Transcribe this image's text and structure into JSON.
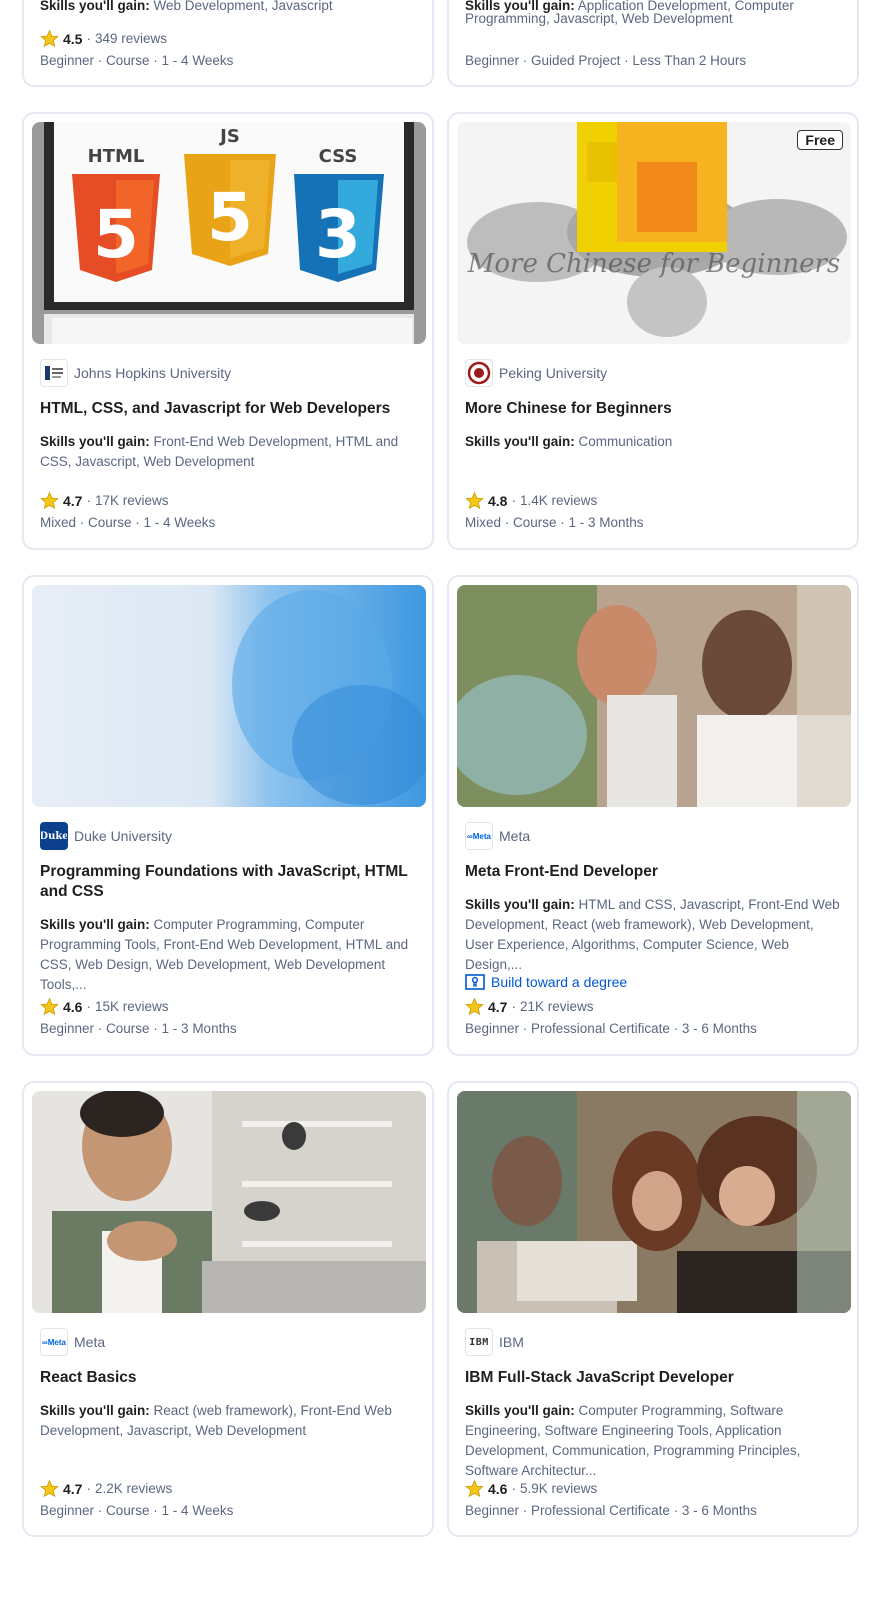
{
  "top_cards": [
    {
      "skills_partial": "Web Development, Javascript",
      "rating": "4.5",
      "reviews": "349 reviews",
      "meta": "Beginner · Course · 1 - 4 Weeks"
    },
    {
      "skills_partial_1": "Application Development, Computer",
      "skills_partial_2": "Programming, Javascript, Web Development",
      "meta": "Beginner · Guided Project · Less Than 2 Hours"
    }
  ],
  "labels": {
    "skills_prefix": "Skills you'll gain:",
    "free": "Free",
    "build_degree": "Build toward a degree"
  },
  "cards": [
    {
      "partner": "Johns Hopkins University",
      "logo_icon": "johns-hopkins-logo",
      "title": "HTML, CSS, and Javascript for Web Developers",
      "skills": "Front-End Web Development, HTML and CSS, Javascript, Web Development",
      "rating": "4.7",
      "reviews": "17K reviews",
      "meta": "Mixed · Course · 1 - 4 Weeks"
    },
    {
      "partner": "Peking University",
      "logo_icon": "peking-university-logo",
      "title": "More Chinese for Beginners",
      "skills": "Communication",
      "rating": "4.8",
      "reviews": "1.4K reviews",
      "meta": "Mixed · Course · 1 - 3 Months"
    },
    {
      "partner": "Duke University",
      "logo_icon": "duke-logo",
      "title": "Programming Foundations with JavaScript, HTML and CSS",
      "skills": "Computer Programming, Computer Programming Tools, Front-End Web Development, HTML and CSS, Web Design, Web Development, Web Development Tools,...",
      "rating": "4.6",
      "reviews": "15K reviews",
      "meta": "Beginner · Course · 1 - 3 Months"
    },
    {
      "partner": "Meta",
      "logo_icon": "meta-logo",
      "title": "Meta Front-End Developer",
      "skills": "HTML and CSS, Javascript, Front-End Web Development, React (web framework), Web Development, User Experience, Algorithms, Computer Science, Web Design,...",
      "rating": "4.7",
      "reviews": "21K reviews",
      "meta": "Beginner · Professional Certificate · 3 - 6 Months"
    },
    {
      "partner": "Meta",
      "logo_icon": "meta-logo",
      "title": "React Basics",
      "skills": "React (web framework), Front-End Web Development, Javascript, Web Development",
      "rating": "4.7",
      "reviews": "2.2K reviews",
      "meta": "Beginner · Course · 1 - 4 Weeks"
    },
    {
      "partner": "IBM",
      "logo_icon": "ibm-logo",
      "title": "IBM Full-Stack JavaScript Developer",
      "skills": "Computer Programming, Software Engineering, Software Engineering Tools, Application Development, Communication, Programming Principles, Software Architectur...",
      "rating": "4.6",
      "reviews": "5.9K reviews",
      "meta": "Beginner · Professional Certificate · 3 - 6 Months"
    }
  ],
  "colors": {
    "star": "#f5c518",
    "link": "#0056d2",
    "border": "#e3e8f2"
  }
}
